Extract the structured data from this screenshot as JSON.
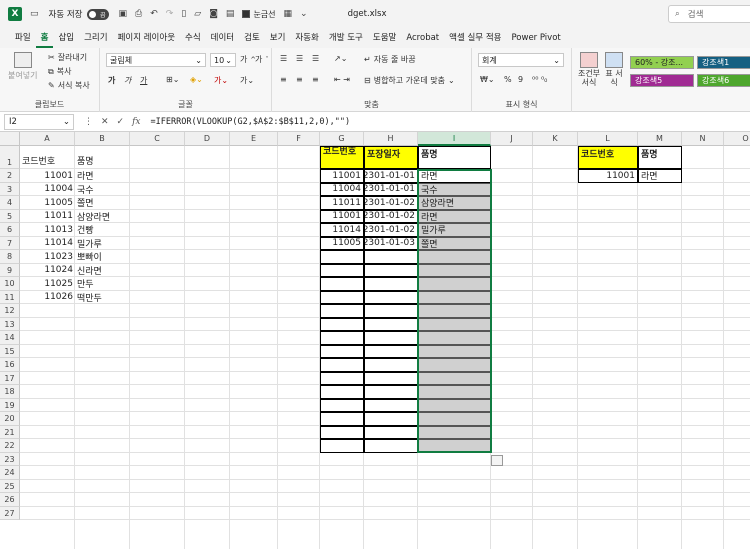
{
  "titlebar": {
    "autosave_label": "자동 저장",
    "autosave_state": "끔",
    "gridlines_label": "눈금선",
    "filename": "dget.xlsx",
    "search_placeholder": "검색"
  },
  "tabs": [
    "파일",
    "홈",
    "삽입",
    "그리기",
    "페이지 레이아웃",
    "수식",
    "데이터",
    "검토",
    "보기",
    "자동화",
    "개발 도구",
    "도움말",
    "Acrobat",
    "액셀 실무 적용",
    "Power Pivot"
  ],
  "active_tab": "홈",
  "ribbon": {
    "clipboard": {
      "label": "클립보드",
      "paste": "붙여넣기",
      "cut": "잘라내기",
      "copy": "복사",
      "format_painter": "서식 복사"
    },
    "font": {
      "label": "글꼴",
      "font_name": "굴림체",
      "font_size": "10",
      "bold": "가",
      "italic": "가",
      "underline": "가"
    },
    "alignment": {
      "label": "맞춤",
      "wrap": "자동 줄 바꿈",
      "merge": "병합하고 가운데 맞춤"
    },
    "number": {
      "label": "표시 형식",
      "format": "회계",
      "percent": "%",
      "comma": "9"
    },
    "styles": {
      "conditional": "조건부 서식",
      "table": "표 서식",
      "chip1": "60% - 강조...",
      "chip2": "강조색1",
      "chip3": "강조색5",
      "chip4": "강조색6",
      "chip1_color": "#92d050",
      "chip2_color": "#156082",
      "chip3_color": "#a02b93",
      "chip4_color": "#4ea72e"
    }
  },
  "formula_bar": {
    "cell_ref": "I2",
    "fx": "fx",
    "formula": "=IFERROR(VLOOKUP(G2,$A$2:$B$11,2,0),\"\")"
  },
  "sheet": {
    "columns": [
      "A",
      "B",
      "C",
      "D",
      "E",
      "F",
      "G",
      "H",
      "I",
      "J",
      "K",
      "L",
      "M",
      "N",
      "O"
    ],
    "selected_column": "I",
    "rows": [
      "1",
      "2",
      "3",
      "4",
      "5",
      "6",
      "7",
      "8",
      "9",
      "10",
      "11",
      "12",
      "13",
      "14",
      "15",
      "16",
      "17",
      "18",
      "19",
      "20",
      "21",
      "22",
      "23",
      "24",
      "25",
      "26",
      "27"
    ],
    "table_a": {
      "header_code": "코드번호",
      "header_name": "품명",
      "rows": [
        {
          "code": "11001",
          "name": "라면"
        },
        {
          "code": "11004",
          "name": "국수"
        },
        {
          "code": "11005",
          "name": "쫄면"
        },
        {
          "code": "11011",
          "name": "삼양라면"
        },
        {
          "code": "11013",
          "name": "건빵"
        },
        {
          "code": "11014",
          "name": "밀가루"
        },
        {
          "code": "11023",
          "name": "뽀빠이"
        },
        {
          "code": "11024",
          "name": "신라면"
        },
        {
          "code": "11025",
          "name": "만두"
        },
        {
          "code": "11026",
          "name": "떡만두"
        }
      ]
    },
    "table_g": {
      "header_code": "코드번호",
      "header_date": "포장일자",
      "header_name": "품명",
      "rows": [
        {
          "code": "11001",
          "date": "2301-01-01",
          "name": "라면"
        },
        {
          "code": "11004",
          "date": "2301-01-01",
          "name": "국수"
        },
        {
          "code": "11011",
          "date": "2301-01-02",
          "name": "삼양라면"
        },
        {
          "code": "11001",
          "date": "2301-01-02",
          "name": "라면"
        },
        {
          "code": "11014",
          "date": "2301-01-02",
          "name": "밀가루"
        },
        {
          "code": "11005",
          "date": "2301-01-03",
          "name": "쫄면"
        }
      ]
    },
    "lookup": {
      "header_code": "코드번호",
      "header_name": "품명",
      "code": "11001",
      "name": "라면"
    }
  }
}
